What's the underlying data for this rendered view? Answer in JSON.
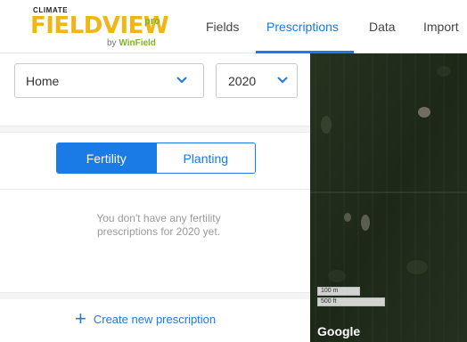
{
  "logo": {
    "brand_top": "CLIMATE",
    "brand_main": "FIELDVIEW",
    "brand_pro": "pro",
    "by_prefix": "by",
    "by_name": "WinField"
  },
  "nav": {
    "fields": "Fields",
    "prescriptions": "Prescriptions",
    "data": "Data",
    "import": "Import",
    "active": "Prescriptions"
  },
  "filters": {
    "farm_value": "Home",
    "year_value": "2020"
  },
  "tabs": {
    "fertility": "Fertility",
    "planting": "Planting",
    "selected": "Fertility"
  },
  "empty_state": {
    "line1": "You don't have any fertility",
    "line2": "prescriptions for 2020 yet."
  },
  "actions": {
    "create_icon": "plus-icon",
    "create_label": "Create new prescription"
  },
  "map": {
    "scale_metric": "100 m",
    "scale_imperial": "500 ft",
    "attribution": "Google"
  },
  "colors": {
    "accent": "#1a7ae6",
    "logo_yellow": "#f2b515",
    "logo_green": "#7bb42d",
    "muted_text": "#9a9a9a"
  }
}
